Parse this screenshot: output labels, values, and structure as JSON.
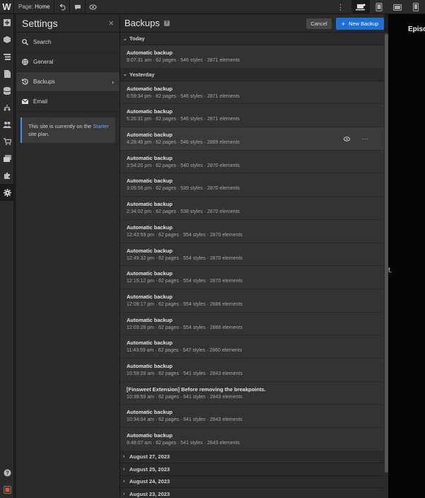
{
  "topbar": {
    "logo": "W",
    "page_prefix": "Page:",
    "page_name": "Home",
    "more": "⋮"
  },
  "settings": {
    "title": "Settings",
    "close": "×",
    "nav": [
      {
        "label": "Search",
        "icon": "search-icon"
      },
      {
        "label": "General",
        "icon": "general-icon"
      },
      {
        "label": "Backups",
        "icon": "backup-icon",
        "active": true
      },
      {
        "label": "Email",
        "icon": "email-icon"
      }
    ],
    "plan_text": "This site is currently on the",
    "plan_link": "Starter",
    "plan_suffix": "site plan."
  },
  "backups": {
    "title": "Backups",
    "help": "?",
    "cancel": "Cancel",
    "new_backup": "New Backup",
    "today_label": "Today",
    "yesterday_label": "Yesterday",
    "today": [
      {
        "title": "Automatic backup",
        "meta": "9:07:31 am · 62 pages · 546 styles · 2871 elements"
      }
    ],
    "yesterday": [
      {
        "title": "Automatic backup",
        "meta": "6:59:34 pm · 62 pages · 546 styles · 2871 elements"
      },
      {
        "title": "Automatic backup",
        "meta": "5:26:31 pm · 62 pages · 546 styles · 2871 elements"
      },
      {
        "title": "Automatic backup",
        "meta": "4:28:45 pm · 62 pages · 546 styles · 2869 elements"
      },
      {
        "title": "Automatic backup",
        "meta": "3:54:20 pm · 62 pages · 540 styles · 2870 elements"
      },
      {
        "title": "Automatic backup",
        "meta": "3:05:56 pm · 62 pages · 539 styles · 2870 elements"
      },
      {
        "title": "Automatic backup",
        "meta": "2:34:02 pm · 62 pages · 538 styles · 2870 elements"
      },
      {
        "title": "Automatic backup",
        "meta": "12:43:59 pm · 62 pages · 554 styles · 2870 elements"
      },
      {
        "title": "Automatic backup",
        "meta": "12:49:32 pm · 62 pages · 554 styles · 2870 elements"
      },
      {
        "title": "Automatic backup",
        "meta": "12:15:12 pm · 62 pages · 554 styles · 2870 elements"
      },
      {
        "title": "Automatic backup",
        "meta": "12:09:17 pm · 62 pages · 554 styles · 2886 elements"
      },
      {
        "title": "Automatic backup",
        "meta": "12:03:28 pm · 62 pages · 554 styles · 2886 elements"
      },
      {
        "title": "Automatic backup",
        "meta": "11:43:59 am · 62 pages · 547 styles · 2860 elements"
      },
      {
        "title": "Automatic backup",
        "meta": "10:59:28 am · 62 pages · 541 styles · 2843 elements"
      },
      {
        "title": "[Finsweet Extension] Before removing the breakpoints.",
        "meta": "10:39:59 am · 62 pages · 541 styles · 2843 elements"
      },
      {
        "title": "Automatic backup",
        "meta": "10:34:04 am · 62 pages · 541 styles · 2843 elements"
      },
      {
        "title": "Automatic backup",
        "meta": "9:48:07 am · 62 pages · 541 styles · 2843 elements"
      }
    ],
    "older_groups": [
      "August 27, 2023",
      "August 25, 2023",
      "August 24, 2023",
      "August 23, 2023"
    ],
    "row_actions": {
      "preview_icon": "eye-icon",
      "more": "···"
    }
  },
  "canvas": {
    "title_fragment": "Episo",
    "text_fragment": "t."
  },
  "colors": {
    "accent": "#1f6fd6",
    "panel": "#2b2b2b",
    "list": "#333333"
  }
}
